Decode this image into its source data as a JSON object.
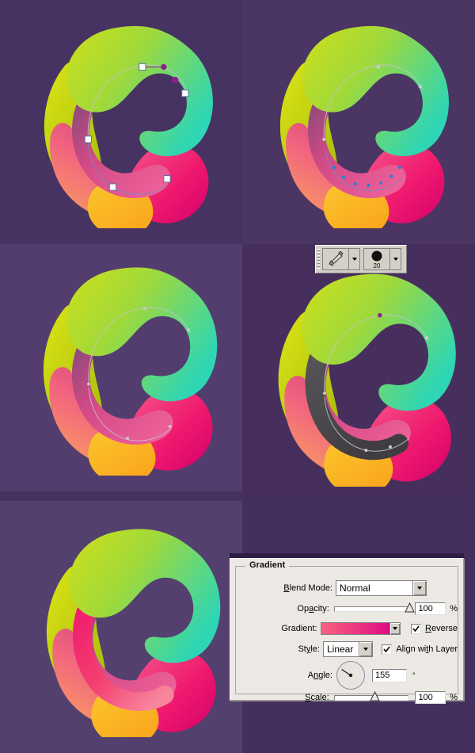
{
  "app": {
    "background_color": "#452f5e",
    "artwork_letter": "C"
  },
  "panels": [
    {
      "id": "panel-tl",
      "name": "step-1-path-selected",
      "bg": "#473361"
    },
    {
      "id": "panel-tr",
      "name": "step-2-path-stroke-preview",
      "bg": "#4a3563"
    },
    {
      "id": "panel-ml",
      "name": "step-3-path-visible",
      "bg": "#533d6e"
    },
    {
      "id": "panel-mr",
      "name": "step-4-grey-stroke",
      "bg": "#472f5d"
    },
    {
      "id": "panel-bl",
      "name": "step-5-final-pink-stroke",
      "bg": "#53406f"
    }
  ],
  "brush_toolbar": {
    "tool_icon": "paintbrush-icon",
    "tool_dropdown_icon": "chevron-down-icon",
    "brush_preview_icon": "brush-tip-circle-icon",
    "brush_size": "20",
    "brush_dropdown_icon": "chevron-down-icon",
    "gripper_icon": "drag-gripper-icon"
  },
  "gradient_dialog": {
    "group_title": "Gradient",
    "blend_mode": {
      "label": "Blend Mode:",
      "accel": "B",
      "value": "Normal",
      "dropdown_icon": "chevron-down-icon"
    },
    "opacity": {
      "label": "Opacity:",
      "accel": "a",
      "value": "100",
      "unit": "%",
      "slider_percent": 100
    },
    "gradient": {
      "label": "Gradient:",
      "swatch_from": "#f8637f",
      "swatch_to": "#e00b86",
      "dropdown_icon": "chevron-down-icon",
      "reverse_label": "Reverse",
      "reverse_accel": "R",
      "reverse_checked": true
    },
    "style": {
      "label": "Style:",
      "accel": "y",
      "value": "Linear",
      "dropdown_icon": "chevron-down-icon",
      "align_label": "Align with Layer",
      "align_accel": "t",
      "align_checked": true
    },
    "angle": {
      "label": "Angle:",
      "accel": "n",
      "value": "155",
      "unit": "°",
      "dial_icon": "angle-dial-icon"
    },
    "scale": {
      "label": "Scale:",
      "accel": "S",
      "value": "100",
      "unit": "%",
      "slider_percent": 50
    }
  },
  "artwork_colors": {
    "green_light": "#b5e02c",
    "green_teal": "#2ed6b4",
    "olive": "#cbdd14",
    "magenta": "#ef1a6e",
    "pink": "#f4568a",
    "orange": "#fcb023",
    "orange_deep": "#f77a4f",
    "grey_stroke": "#4e4c4e",
    "purple_stroke": "#6d3f6e"
  }
}
